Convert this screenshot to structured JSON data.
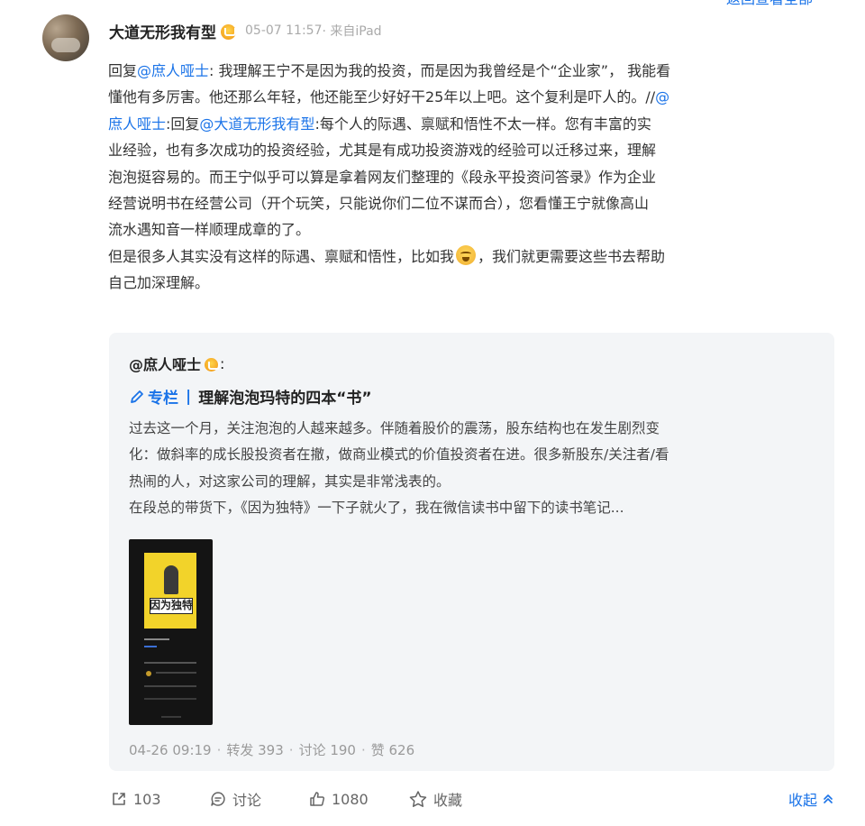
{
  "top_link": "返回查看全部",
  "post": {
    "author": "大道无形我有型",
    "time": "05-07 11:57",
    "source": "· 来自iPad",
    "body_lines": [
      [
        {
          "t": "回复"
        },
        {
          "t": "@庶人哑士",
          "m": true
        },
        {
          "t": ": 我理解王宁不是因为我的投资，而是因为我曾经是个“企业家”， 我能看"
        }
      ],
      [
        {
          "t": "懂他有多厉害。他还那么年轻，他还能至少好好干25年以上吧。这个复利是吓人的。//"
        },
        {
          "t": "@",
          "m": true
        }
      ],
      [
        {
          "t": "庶人哑士",
          "m": true
        },
        {
          "t": ":回复"
        },
        {
          "t": "@大道无形我有型",
          "m": true
        },
        {
          "t": ":每个人的际遇、禀赋和悟性不太一样。您有丰富的实"
        }
      ],
      [
        {
          "t": "业经验，也有多次成功的投资经验，尤其是有成功投资游戏的经验可以迁移过来，理解"
        }
      ],
      [
        {
          "t": "泡泡挺容易的。而王宁似乎可以算是拿着网友们整理的《段永平投资问答录》作为企业"
        }
      ],
      [
        {
          "t": "经营说明书在经营公司（开个玩笑，只能说你们二位不谋而合），您看懂王宁就像高山"
        }
      ],
      [
        {
          "t": "流水遇知音一样顺理成章的了。"
        }
      ],
      [
        {
          "t": "但是很多人其实没有这样的际遇、禀赋和悟性，比如我"
        },
        {
          "emoji": "laughing-crying-emoji"
        },
        {
          "t": "，我们就更需要这些书去帮助"
        }
      ],
      [
        {
          "t": "自己加深理解。"
        }
      ]
    ]
  },
  "repost": {
    "author": "@庶人哑士",
    "colon": ":",
    "column_tag": "专栏",
    "column_sep": "|",
    "column_title": "理解泡泡玛特的四本“书”",
    "text_lines": [
      "过去这一个月，关注泡泡的人越来越多。伴随着股价的震荡，股东结构也在发生剧烈变",
      "化：做斜率的成长股投资者在撤，做商业模式的价值投资者在进。很多新股东/关注者/看",
      "热闹的人，对这家公司的理解，其实是非常浅表的。",
      "在段总的带货下，《因为独特》一下子就火了，我在微信读书中留下的读书笔记..."
    ],
    "book_cover_title": "因为独特",
    "stats": {
      "time": "04-26 09:19",
      "repost": "转发 393",
      "comment": "讨论 190",
      "like": "赞 626"
    }
  },
  "footer": {
    "share_count": "103",
    "comment_label": "讨论",
    "like_count": "1080",
    "favorite_label": "收藏",
    "collapse_label": "收起"
  },
  "colors": {
    "link": "#1a73e8",
    "card_bg": "#f3f5f7",
    "meta": "#aaaaaa",
    "badge": "#f5a623"
  }
}
